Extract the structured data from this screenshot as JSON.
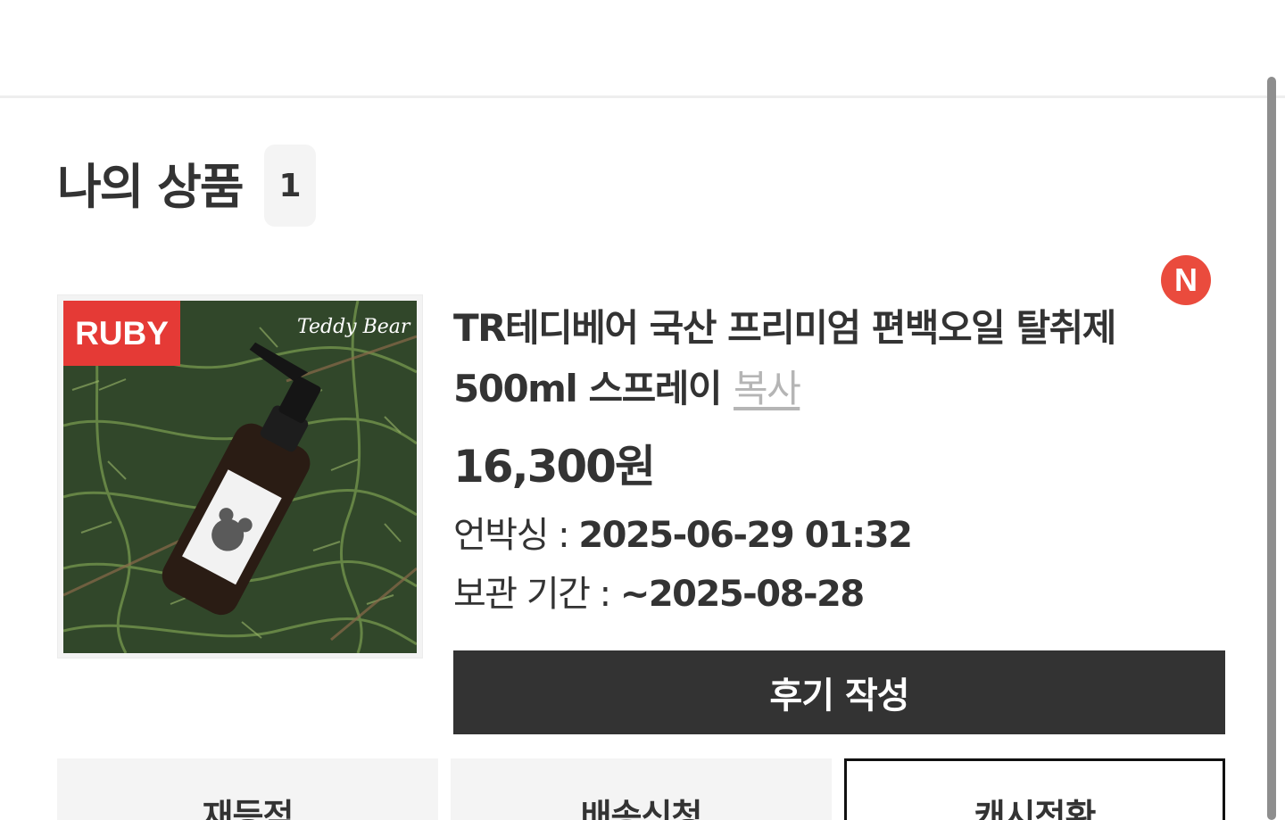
{
  "header": {},
  "section": {
    "title": "나의 상품",
    "count": "1"
  },
  "product": {
    "grade_badge": "RUBY",
    "new_badge": "N",
    "name": "TR테디베어 국산 프리미엄 편백오일 탈취제 500ml 스프레이",
    "copy_label": "복사",
    "price": "16,300원",
    "unboxing_label": "언박싱 : ",
    "unboxing_value": "2025-06-29 01:32",
    "keep_label": "보관 기간 : ",
    "keep_value": "~2025-08-28",
    "image_brand_text": "Teddy Bear"
  },
  "actions": {
    "review_label": "후기 작성",
    "resale_label": "재등적",
    "delivery_label": "배송신청",
    "cash_label": "캐시전환"
  },
  "colors": {
    "grade_badge": "#e53a36",
    "new_badge": "#ea4b3d",
    "primary_button": "#333333",
    "copy_link": "#b5b5b5"
  }
}
